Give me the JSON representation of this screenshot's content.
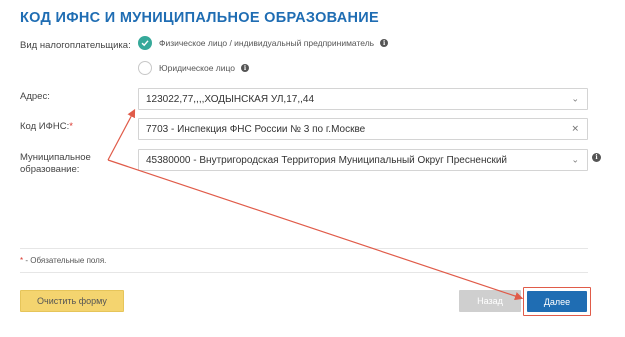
{
  "title": "КОД ИФНС И МУНИЦИПАЛЬНОЕ ОБРАЗОВАНИЕ",
  "taxpayer": {
    "label": "Вид налогоплательщика:",
    "options": [
      {
        "label": "Физическое лицо / индивидуальный предприниматель",
        "checked": true
      },
      {
        "label": "Юридическое лицо",
        "checked": false
      }
    ]
  },
  "address": {
    "label": "Адрес:",
    "value": "123022,77,,,,ХОДЫНСКАЯ УЛ,17,,44"
  },
  "ifns": {
    "label": "Код ИФНС:",
    "required_mark": "*",
    "value": "7703 - Инспекция ФНС России № 3 по г.Москве"
  },
  "municipal": {
    "label_line1": "Муниципальное",
    "label_line2": "образование:",
    "value": "45380000 - Внутригородская Территория Муниципальный Округ Пресненский"
  },
  "note": {
    "mark": "*",
    "text": " - Обязательные поля."
  },
  "buttons": {
    "clear": "Очистить форму",
    "back": "Назад",
    "next": "Далее"
  },
  "colors": {
    "accent": "#1f6db3",
    "check": "#36a99a",
    "clear_btn": "#f4d46f",
    "annotation": "#e05b49"
  }
}
